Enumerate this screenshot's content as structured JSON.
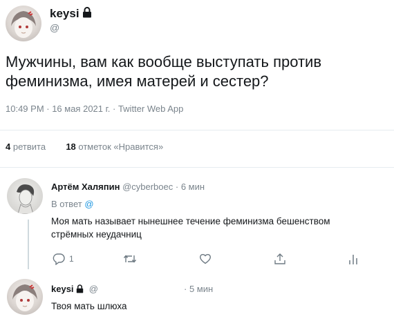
{
  "main_tweet": {
    "author_name": "keysi",
    "handle": "@",
    "text_line1": "Мужчины, вам как вообще выступать против",
    "text_line2": "феминизма, имея матерей и сестер?",
    "meta": "10:49 PM · 16 мая 2021 г. · Twitter Web App",
    "retweets_count": "4",
    "retweets_label": "ретвита",
    "likes_count": "18",
    "likes_label": "отметок «Нравится»"
  },
  "reply": {
    "author_name": "Артём Халяпин",
    "handle": "@cyberboec",
    "time": "· 6 мин",
    "reply_to_prefix": "В ответ",
    "reply_to_handle": "@",
    "text_line1": "Моя мать называет нынешнее течение феминизма бешенством",
    "text_line2": "стрёмных неудачниц",
    "reply_count": "1"
  },
  "reply2": {
    "author_name": "keysi",
    "handle": "@",
    "time": "· 5 мин",
    "text": "Твоя мать шлюха"
  },
  "icons": [
    "lock-icon",
    "comment-icon",
    "retweet-icon",
    "like-icon",
    "share-icon",
    "analytics-icon"
  ],
  "colors": {
    "accent": "#1b95e0",
    "muted": "#7a848c",
    "text": "#14171a",
    "divider": "#e6ecf0"
  }
}
